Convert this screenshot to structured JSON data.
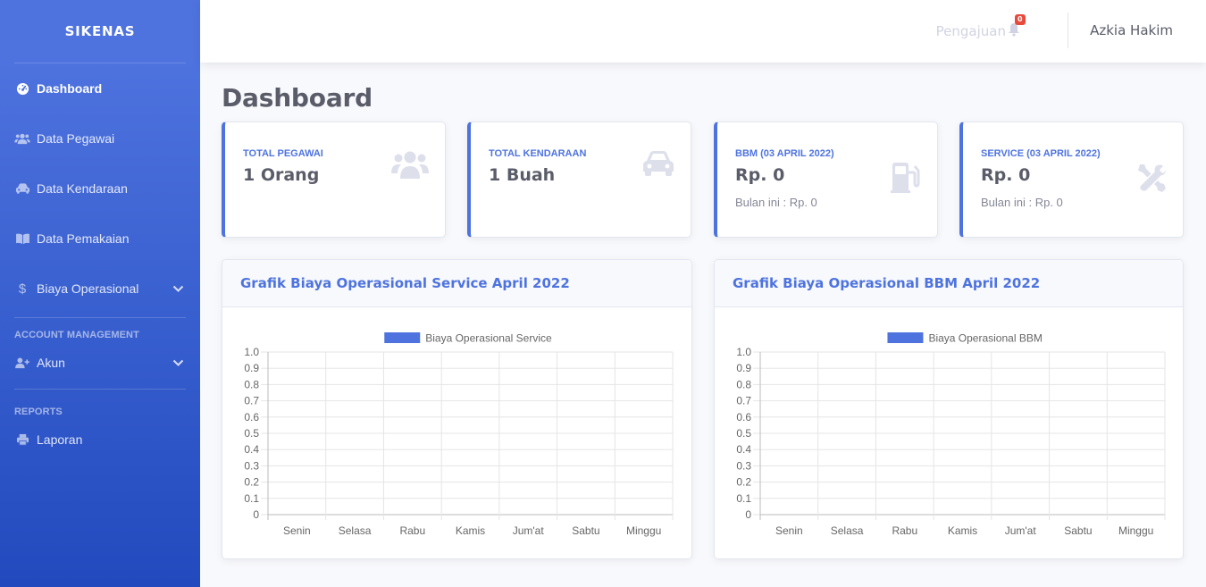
{
  "sidebar": {
    "brand": "SIKENAS",
    "items": [
      {
        "label": "Dashboard",
        "icon": "tachometer-icon"
      },
      {
        "label": "Data Pegawai",
        "icon": "users-icon"
      },
      {
        "label": "Data Kendaraan",
        "icon": "car-icon"
      },
      {
        "label": "Data Pemakaian",
        "icon": "book-icon"
      },
      {
        "label": "Biaya Operasional",
        "icon": "dollar-icon"
      }
    ],
    "heading_account": "ACCOUNT MANAGEMENT",
    "akun_label": "Akun",
    "heading_reports": "REPORTS",
    "laporan_label": "Laporan"
  },
  "topbar": {
    "pengajuan_label": "Pengajuan",
    "badge_count": "0",
    "username": "Azkia Hakim"
  },
  "page": {
    "title": "Dashboard"
  },
  "cards": [
    {
      "label": "TOTAL PEGAWAI",
      "value": "1 Orang",
      "sub": "",
      "icon": "users-icon"
    },
    {
      "label": "TOTAL KENDARAAN",
      "value": "1 Buah",
      "sub": "",
      "icon": "car-icon"
    },
    {
      "label": "BBM (03 APRIL 2022)",
      "value": "Rp. 0",
      "sub": "Bulan ini : Rp. 0",
      "icon": "gas-pump-icon"
    },
    {
      "label": "SERVICE (03 APRIL 2022)",
      "value": "Rp. 0",
      "sub": "Bulan ini : Rp. 0",
      "icon": "tools-icon"
    }
  ],
  "panels": [
    {
      "title": "Grafik Biaya Operasional Service April 2022"
    },
    {
      "title": "Grafik Biaya Operasional BBM April 2022"
    }
  ],
  "colors": {
    "primary": "#4e73df",
    "sidebar_end": "#224abe",
    "text": "#5a5c69",
    "badge": "#e74a3b"
  },
  "chart_data": [
    {
      "type": "bar",
      "title": "",
      "categories": [
        "Senin",
        "Selasa",
        "Rabu",
        "Kamis",
        "Jum'at",
        "Sabtu",
        "Minggu"
      ],
      "series": [
        {
          "name": "Biaya Operasional Service",
          "values": [
            0,
            0,
            0,
            0,
            0,
            0,
            0
          ]
        }
      ],
      "ylim": [
        0,
        1.0
      ],
      "yticks": [
        "0",
        "0.1",
        "0.2",
        "0.3",
        "0.4",
        "0.5",
        "0.6",
        "0.7",
        "0.8",
        "0.9",
        "1.0"
      ],
      "legend": "top",
      "grid": true
    },
    {
      "type": "bar",
      "title": "",
      "categories": [
        "Senin",
        "Selasa",
        "Rabu",
        "Kamis",
        "Jum'at",
        "Sabtu",
        "Minggu"
      ],
      "series": [
        {
          "name": "Biaya Operasional BBM",
          "values": [
            0,
            0,
            0,
            0,
            0,
            0,
            0
          ]
        }
      ],
      "ylim": [
        0,
        1.0
      ],
      "yticks": [
        "0",
        "0.1",
        "0.2",
        "0.3",
        "0.4",
        "0.5",
        "0.6",
        "0.7",
        "0.8",
        "0.9",
        "1.0"
      ],
      "legend": "top",
      "grid": true
    }
  ]
}
